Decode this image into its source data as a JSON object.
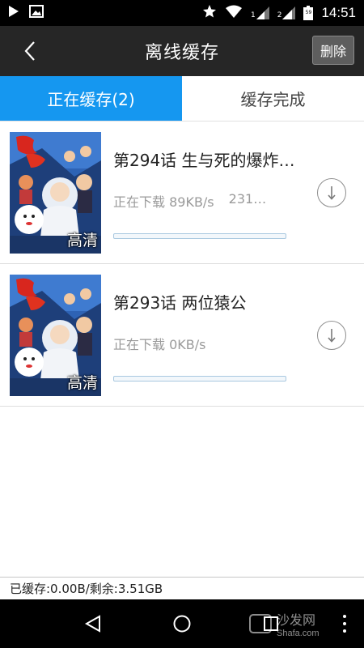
{
  "status_bar": {
    "time": "14:51",
    "sim1": "1",
    "sim2": "2",
    "battery_level": "59"
  },
  "header": {
    "title": "离线缓存",
    "delete_label": "删除"
  },
  "tabs": [
    {
      "label": "正在缓存(2)",
      "active": true
    },
    {
      "label": "缓存完成",
      "active": false
    }
  ],
  "downloads": [
    {
      "title": "第294话 生与死的爆炸…",
      "status": "正在下载 89KB/s",
      "size": "231…",
      "badge": "高清",
      "progress": 0.0
    },
    {
      "title": "第293话 两位猿公",
      "status": "正在下载 0KB/s",
      "size": "",
      "badge": "高清",
      "progress": 0.0
    }
  ],
  "storage": {
    "text": "已缓存:0.00B/剩余:3.51GB"
  },
  "watermark": {
    "cn": "沙发网",
    "en": "Shafa.com"
  },
  "colors": {
    "accent": "#1597f0",
    "titlebar": "#262626"
  }
}
